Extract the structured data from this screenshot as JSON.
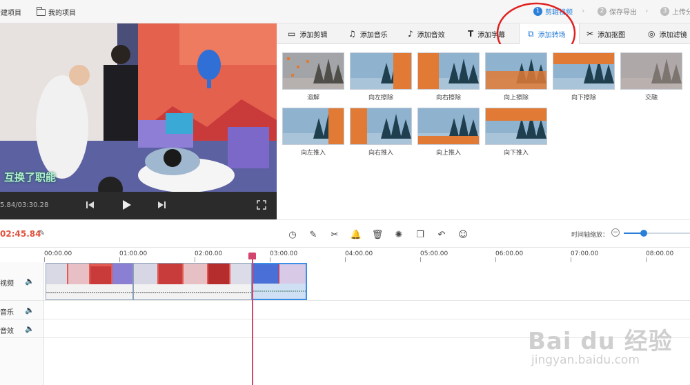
{
  "topbar": {
    "new_project": "新建项目",
    "my_projects": "我的项目",
    "steps": [
      {
        "num": "1",
        "label": "剪辑视频",
        "active": true
      },
      {
        "num": "2",
        "label": "保存导出",
        "active": false
      },
      {
        "num": "3",
        "label": "上传分",
        "active": false
      }
    ]
  },
  "preview": {
    "caption": "互换了职能",
    "time": "5.84/03:30.28"
  },
  "tabs": [
    {
      "label": "添加剪辑",
      "icon": "video-camera-icon"
    },
    {
      "label": "添加音乐",
      "icon": "music-note-icon"
    },
    {
      "label": "添加音效",
      "icon": "sound-effect-icon"
    },
    {
      "label": "添加字幕",
      "icon": "text-icon"
    },
    {
      "label": "添加转场",
      "icon": "transition-icon",
      "active": true
    },
    {
      "label": "添加抠图",
      "icon": "cutout-icon"
    },
    {
      "label": "添加滤镜",
      "icon": "filter-icon"
    }
  ],
  "transitions": [
    {
      "label": "溶解",
      "style": "dissolve"
    },
    {
      "label": "向左擦除",
      "style": "wipe-left"
    },
    {
      "label": "向右擦除",
      "style": "wipe-right"
    },
    {
      "label": "向上擦除",
      "style": "wipe-up"
    },
    {
      "label": "向下擦除",
      "style": "wipe-down"
    },
    {
      "label": "交融",
      "style": "blend"
    },
    {
      "label": "向左推入",
      "style": "push-left"
    },
    {
      "label": "向右推入",
      "style": "push-right"
    },
    {
      "label": "向上推入",
      "style": "push-up"
    },
    {
      "label": "向下推入",
      "style": "push-down"
    }
  ],
  "timeline": {
    "current_time": "02:45.84",
    "zoom_label": "时间轴缩放：",
    "zoom_level": 0.3,
    "ruler": [
      "00:00.00",
      "01:00.00",
      "02:00.00",
      "03:00.00",
      "04:00.00",
      "05:00.00",
      "06:00.00",
      "07:00.00",
      "08:00.00"
    ],
    "tracks": [
      {
        "label": "视频"
      },
      {
        "label": "音乐"
      },
      {
        "label": "音效"
      }
    ]
  },
  "tools": [
    {
      "name": "speed-icon",
      "glyph": "◷"
    },
    {
      "name": "pencil-icon",
      "glyph": "✎"
    },
    {
      "name": "scissors-icon",
      "glyph": "✂"
    },
    {
      "name": "bell-icon",
      "glyph": "🔔"
    },
    {
      "name": "trash-icon",
      "glyph": "🗑"
    },
    {
      "name": "magic-icon",
      "glyph": "✺"
    },
    {
      "name": "copy-icon",
      "glyph": "❐"
    },
    {
      "name": "undo-icon",
      "glyph": "↶"
    },
    {
      "name": "emoji-icon",
      "glyph": "☺"
    }
  ],
  "watermark": {
    "brand": "Bai du 经验",
    "url": "jingyan.baidu.com"
  },
  "colors": {
    "accent": "#2a7fd9",
    "time_red": "#e0523e",
    "playhead": "#d3456e",
    "annotation": "#e02020"
  }
}
